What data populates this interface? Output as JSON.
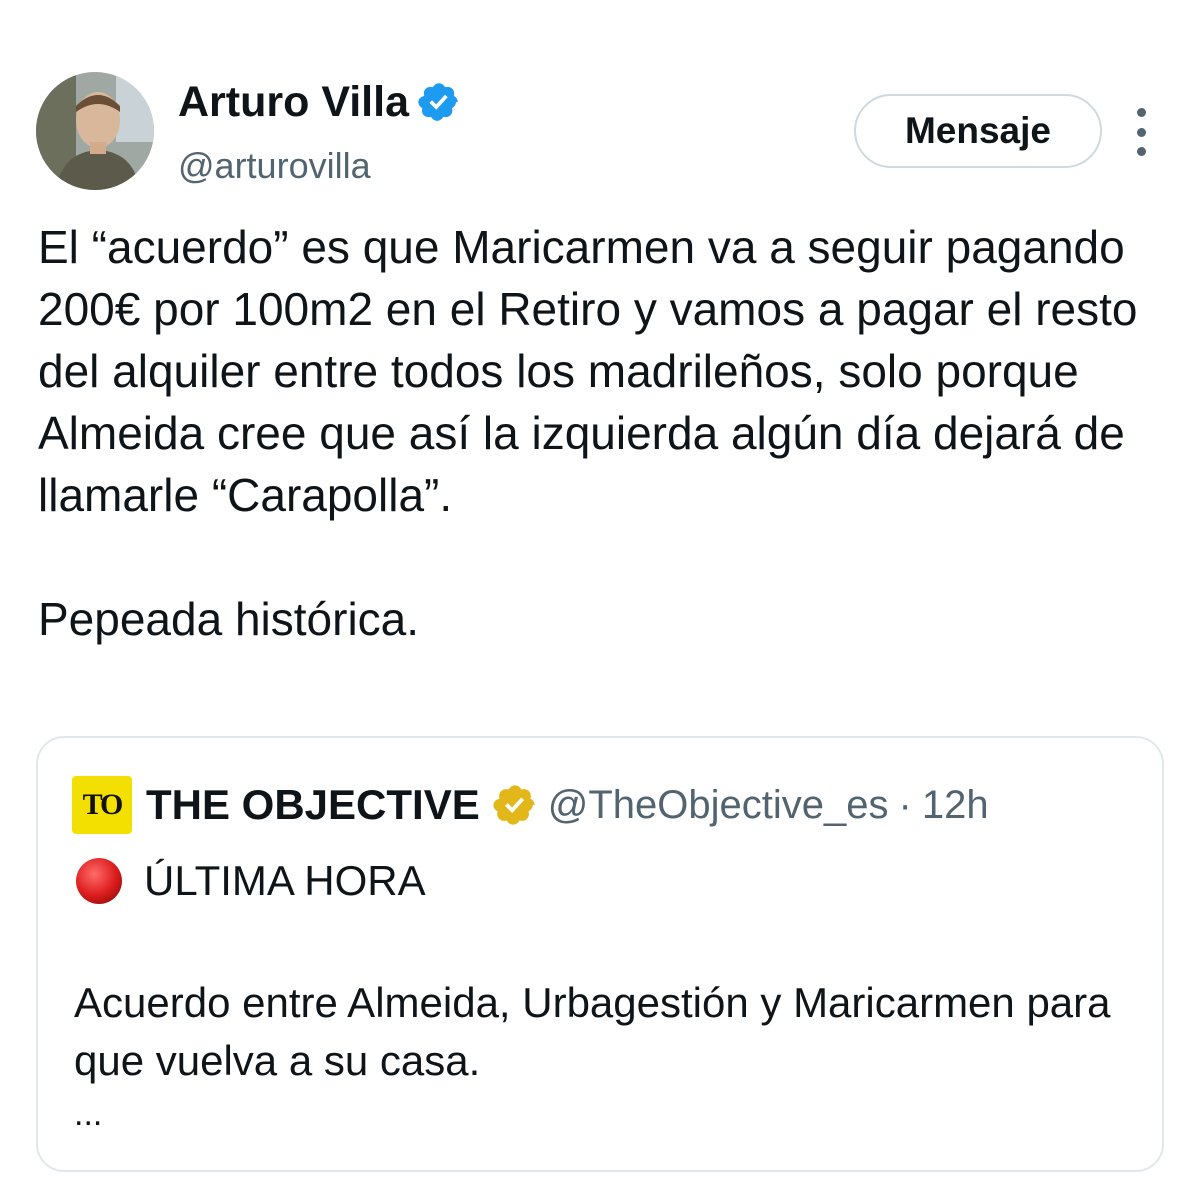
{
  "author": {
    "name": "Arturo Villa",
    "handle": "@arturovilla",
    "avatar_icon": "profile-photo",
    "verified_color": "#1d9bf0"
  },
  "actions": {
    "message_label": "Mensaje",
    "more_icon": "vertical-ellipsis-icon"
  },
  "tweet": {
    "text": "El “acuerdo” es que Maricarmen va a seguir pagando 200€ por 100m2 en el Retiro y vamos a pagar el resto del alquiler entre todos los madrileños, solo porque Almeida cree que así la izquierda algún día dejará de llamarle “Carapolla”.\n\nPepeada histórica."
  },
  "quote": {
    "logo_text": "TO",
    "logo_color": "#f4e000",
    "name": "THE OBJECTIVE",
    "verified_color": "#e2b719",
    "handle": "@TheObjective_es",
    "separator": "·",
    "time": "12h",
    "badge_icon": "red-circle-icon",
    "badge_text": "ÚLTIMA HORA",
    "body": "Acuerdo entre Almeida, Urbagestión y Maricarmen para que vuelva a su casa.",
    "ellipsis": "..."
  }
}
